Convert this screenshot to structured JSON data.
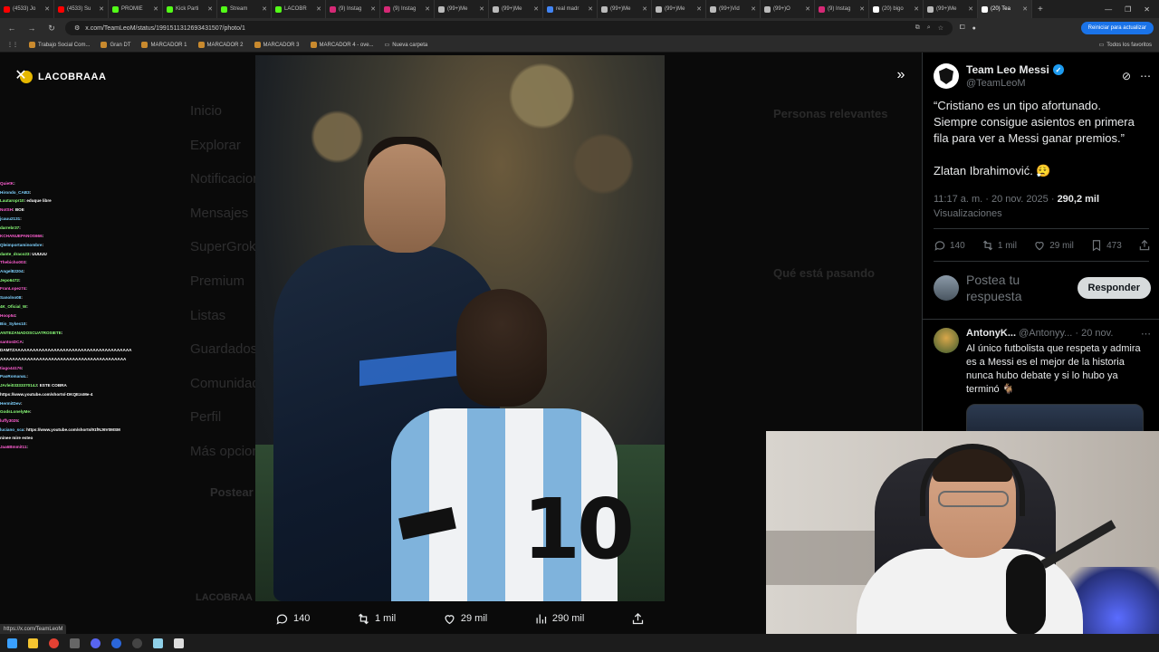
{
  "browser": {
    "tabs": [
      {
        "label": "(4533) Jo",
        "color": "#ff0000"
      },
      {
        "label": "(4533) Su",
        "color": "#ff0000"
      },
      {
        "label": "PROMIE",
        "color": "#53fc18"
      },
      {
        "label": "Kick Parti",
        "color": "#53fc18"
      },
      {
        "label": "Stream",
        "color": "#53fc18"
      },
      {
        "label": "LACOBR",
        "color": "#53fc18"
      },
      {
        "label": "(9) Instag",
        "color": "#d62976"
      },
      {
        "label": "(9) Instag",
        "color": "#d62976"
      },
      {
        "label": "(99+)Me",
        "color": "#bbbbbb"
      },
      {
        "label": "(99+)Me",
        "color": "#bbbbbb"
      },
      {
        "label": "real madr",
        "color": "#4285f4"
      },
      {
        "label": "(99+)Me",
        "color": "#bbbbbb"
      },
      {
        "label": "(99+)Me",
        "color": "#bbbbbb"
      },
      {
        "label": "(99+)Vid",
        "color": "#bbbbbb"
      },
      {
        "label": "(99+)O",
        "color": "#bbbbbb"
      },
      {
        "label": "(9) Instag",
        "color": "#d62976"
      },
      {
        "label": "(20) bigo",
        "color": "#ffffff"
      },
      {
        "label": "(99+)Me",
        "color": "#bbbbbb"
      },
      {
        "label": "(20) Tea",
        "color": "#ffffff",
        "active": true
      }
    ],
    "url": "x.com/TeamLeoM/status/1991511312693431507/photo/1",
    "update_button": "Reiniciar para actualizar",
    "bookmarks": [
      "Trabajo Social Com...",
      "Gran DT",
      "MARCADOR 1",
      "MARCADOR 2",
      "MARCADOR 3",
      "MARCADOR 4 - ove...",
      "Nueva carpeta"
    ],
    "bookmarks_right": "Todos los favoritos",
    "status_url": "https://x.com/TeamLeoM"
  },
  "overlay": {
    "streamer_logo": "LACOBRAAA",
    "chat": [
      {
        "user": "QuietK",
        "msg": ""
      },
      {
        "user": "Hirondo_CAB3",
        "msg": ""
      },
      {
        "user": "Lautaropr10",
        "msg": "eduque libre"
      },
      {
        "user": "NotSH",
        "msg": "BOE"
      },
      {
        "user": "jcauu2131",
        "msg": ""
      },
      {
        "user": "darrebr37",
        "msg": ""
      },
      {
        "user": "KCHANUEPANOS666",
        "msg": ""
      },
      {
        "user": "Qleimportaminombre",
        "msg": ""
      },
      {
        "user": "dante_draco23",
        "msg": "UUUUU"
      },
      {
        "user": "Thebicho003",
        "msg": ""
      },
      {
        "user": "Angel82204",
        "msg": ""
      },
      {
        "user": "Jepo6472",
        "msg": ""
      },
      {
        "user": "FranLopez74",
        "msg": ""
      },
      {
        "user": "Sanolno08",
        "msg": ""
      },
      {
        "user": "4K_Oficial_W",
        "msg": ""
      },
      {
        "user": "Hoop54",
        "msg": ""
      },
      {
        "user": "Bio_Sykes10",
        "msg": ""
      },
      {
        "user": "ANTEZANADOSCUATROSIETE",
        "msg": ""
      },
      {
        "user": "santosDCA",
        "msg": ""
      },
      {
        "user": "",
        "msg": "DAMTZAAAAAAAAAAAAAAAAAAAAAAAAAAAAAAAAAAAAAAA"
      },
      {
        "user": "",
        "msg": "AAAAAAAAAAAAAAAAAAAAAAAAAAAAAAAAAAAAAAAAAA"
      },
      {
        "user": "tiago44176",
        "msg": ""
      },
      {
        "user": "PaoRomanaL",
        "msg": ""
      },
      {
        "user": "JArlei0333337014J",
        "msg": "ESTE COBRA"
      },
      {
        "user": "",
        "msg": "https://www.youtube.com/shorts/-DKQEzsMe-4"
      },
      {
        "user": "HermitDev",
        "msg": ""
      },
      {
        "user": "GodsLonelyMe",
        "msg": ""
      },
      {
        "user": "luffy3025",
        "msg": ""
      },
      {
        "user": "luciano_sca",
        "msg": "https://www.youtube.com/shorts/91fNJ6V0MSM"
      },
      {
        "user": "",
        "msg": "ninee mire esteo"
      },
      {
        "user": "Jaa6Bmmit11",
        "msg": ""
      }
    ]
  },
  "x_page_dim": {
    "nav": [
      "Inicio",
      "Explorar",
      "Notificaciones",
      "Mensajes",
      "SuperGrok",
      "Premium",
      "Listas",
      "Guardados",
      "Comunidades",
      "Perfil",
      "Más opciones"
    ],
    "post_button": "Postear",
    "right_headings": [
      "Personas relevantes",
      "Qué está pasando"
    ],
    "account_label": "LACOBRAA"
  },
  "photo_actions": {
    "replies": "140",
    "reposts": "1 mil",
    "likes": "29 mil",
    "views": "290 mil"
  },
  "tweet": {
    "author_name": "Team Leo Messi",
    "author_handle": "@TeamLeoM",
    "text": "“Cristiano es un tipo afortunado. Siempre consigue asientos en primera fila para ver a Messi ganar premios.”\n\nZlatan Ibrahimović. 😮‍💨",
    "time": "11:17 a. m. · 20 nov. 2025 · ",
    "views_count": "290,2 mil",
    "views_label": "Visualizaciones",
    "stats": {
      "replies": "140",
      "reposts": "1 mil",
      "likes": "29 mil",
      "bookmarks": "473"
    },
    "reply_placeholder": "Postea tu respuesta",
    "reply_button": "Responder"
  },
  "reply": {
    "name": "AntonyK...",
    "handle": "@Antonyy...",
    "date": "· 20 nov.",
    "text": "Al único futbolista que respeta y admira es a Messi es el mejor de la historia nunca hubo debate y si lo hubo ya terminó 🐐"
  },
  "photo": {
    "jersey_number": "10"
  }
}
